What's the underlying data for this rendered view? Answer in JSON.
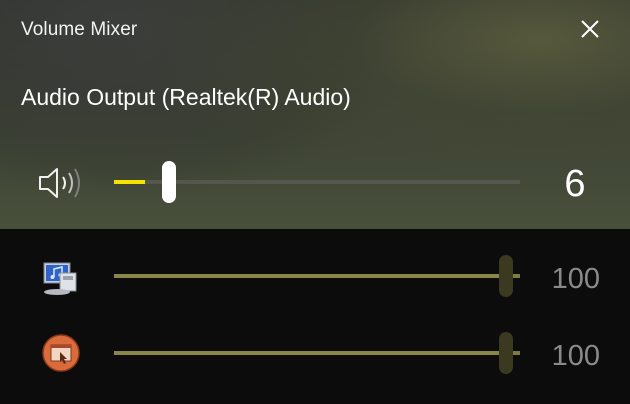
{
  "window": {
    "title": "Volume Mixer",
    "close_icon": "close-icon"
  },
  "device": {
    "name": "Audio Output (Realtek(R) Audio)",
    "icon": "speaker-icon",
    "volume": 6,
    "volume_label": "6",
    "accent_color": "#f5e400"
  },
  "apps": [
    {
      "icon": "system-sounds-icon",
      "volume": 100,
      "volume_label": "100"
    },
    {
      "icon": "app-window-icon",
      "volume": 100,
      "volume_label": "100"
    }
  ]
}
